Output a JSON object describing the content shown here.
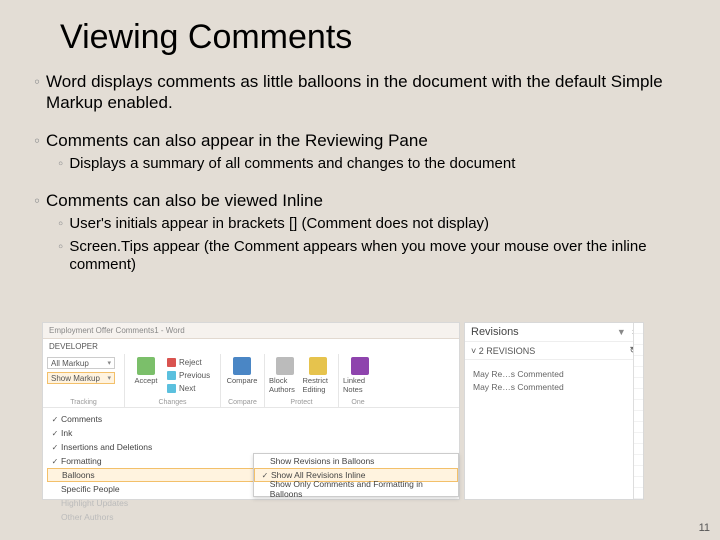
{
  "title": "Viewing Comments",
  "bullets": {
    "b1": "Word displays comments as little balloons in the document with the default Simple Markup enabled.",
    "b2": "Comments can also appear in the Reviewing Pane",
    "b2a": "Displays a summary of all comments and changes to the document",
    "b3": "Comments can also be viewed Inline",
    "b3a": "User's initials appear in brackets [] (Comment does not display)",
    "b3b": "Screen.Tips appear (the Comment appears when you move your mouse over the inline comment)"
  },
  "ribbon": {
    "titlebar": "Employment Offer Comments1 - Word",
    "tab": "DEVELOPER",
    "allMarkup": "All Markup",
    "showMarkup": "Show Markup",
    "prev": "Previous",
    "next": "Next",
    "accept": "Accept",
    "reject": "Reject",
    "compare": "Compare",
    "block": "Block Authors",
    "restrict": "Restrict Editing",
    "linked": "Linked Notes",
    "groups": {
      "g1": "Tracking",
      "g2": "Changes",
      "g3": "Compare",
      "g4": "Protect",
      "g5": "One"
    },
    "menu": {
      "comments": "Comments",
      "ink": "Ink",
      "insdel": "Insertions and Deletions",
      "formatting": "Formatting",
      "balloons": "Balloons",
      "specific": "Specific People",
      "highlight": "Highlight Updates",
      "other": "Other Authors"
    },
    "submenu": {
      "s1": "Show Revisions in Balloons",
      "s2": "Show All Revisions Inline",
      "s3": "Show Only Comments and Formatting in Balloons"
    }
  },
  "revisions": {
    "header": "Revisions",
    "count": "2 REVISIONS",
    "line1": "May Re…s Commented",
    "line2": "May Re…s Commented"
  },
  "pageNumber": "11",
  "marks": {
    "ring": "◦",
    "check": "✓",
    "chev": "▾",
    "chevR": "▸",
    "chevD": "˅",
    "close": "×",
    "pin": "▼",
    "refresh": "↻"
  }
}
